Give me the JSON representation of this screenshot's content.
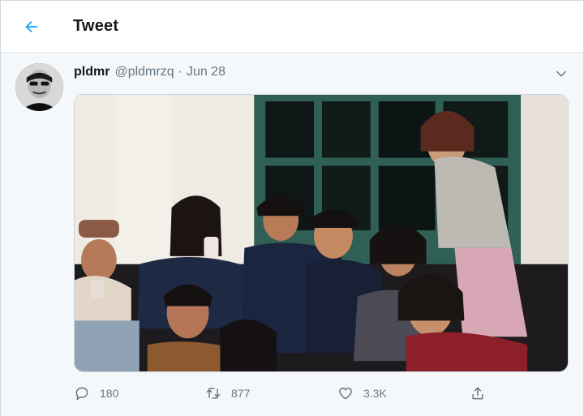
{
  "header": {
    "title": "Tweet",
    "back_icon": "arrow-left-icon",
    "accent": "#1da1f2"
  },
  "tweet": {
    "display_name": "pldmr",
    "handle": "@pldmrzq",
    "separator": "·",
    "time": "Jun 28",
    "menu_icon": "chevron-down-icon",
    "avatar_icon": "profile-avatar",
    "photo": "group-photo"
  },
  "actions": {
    "reply": {
      "icon": "comment-icon",
      "count": "180"
    },
    "retweet": {
      "icon": "retweet-icon",
      "count": "877"
    },
    "like": {
      "icon": "heart-icon",
      "count": "3.3K"
    },
    "share": {
      "icon": "share-icon"
    }
  },
  "colors": {
    "text_primary": "#14171a",
    "text_secondary": "#657786",
    "background_band": "#f5f8fa",
    "border": "#e6ecf0"
  }
}
